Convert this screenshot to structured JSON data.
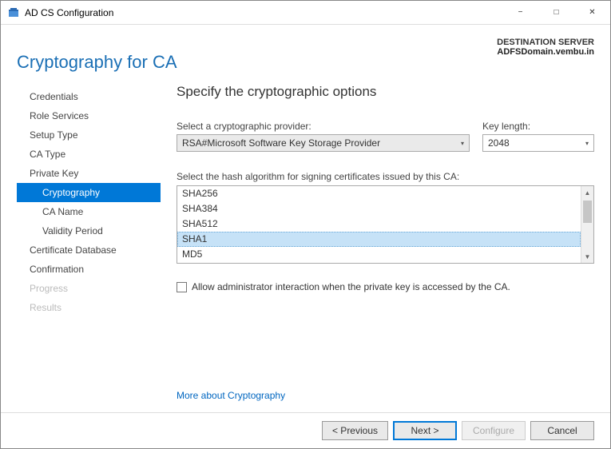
{
  "window": {
    "title": "AD CS Configuration"
  },
  "destination": {
    "label": "DESTINATION SERVER",
    "value": "ADFSDomain.vembu.in"
  },
  "page": {
    "heading": "Cryptography for CA",
    "content_title": "Specify the cryptographic options"
  },
  "sidebar": {
    "items": [
      {
        "label": "Credentials",
        "sub": false,
        "selected": false,
        "disabled": false
      },
      {
        "label": "Role Services",
        "sub": false,
        "selected": false,
        "disabled": false
      },
      {
        "label": "Setup Type",
        "sub": false,
        "selected": false,
        "disabled": false
      },
      {
        "label": "CA Type",
        "sub": false,
        "selected": false,
        "disabled": false
      },
      {
        "label": "Private Key",
        "sub": false,
        "selected": false,
        "disabled": false
      },
      {
        "label": "Cryptography",
        "sub": true,
        "selected": true,
        "disabled": false
      },
      {
        "label": "CA Name",
        "sub": true,
        "selected": false,
        "disabled": false
      },
      {
        "label": "Validity Period",
        "sub": true,
        "selected": false,
        "disabled": false
      },
      {
        "label": "Certificate Database",
        "sub": false,
        "selected": false,
        "disabled": false
      },
      {
        "label": "Confirmation",
        "sub": false,
        "selected": false,
        "disabled": false
      },
      {
        "label": "Progress",
        "sub": false,
        "selected": false,
        "disabled": true
      },
      {
        "label": "Results",
        "sub": false,
        "selected": false,
        "disabled": true
      }
    ]
  },
  "provider": {
    "label": "Select a cryptographic provider:",
    "value": "RSA#Microsoft Software Key Storage Provider"
  },
  "keylength": {
    "label": "Key length:",
    "value": "2048"
  },
  "hash": {
    "label": "Select the hash algorithm for signing certificates issued by this CA:",
    "items": [
      "SHA256",
      "SHA384",
      "SHA512",
      "SHA1",
      "MD5"
    ],
    "selected_index": 3
  },
  "allow_admin": {
    "label": "Allow administrator interaction when the private key is accessed by the CA.",
    "checked": false
  },
  "link": {
    "label": "More about Cryptography"
  },
  "footer": {
    "previous": "< Previous",
    "next": "Next >",
    "configure": "Configure",
    "cancel": "Cancel"
  }
}
